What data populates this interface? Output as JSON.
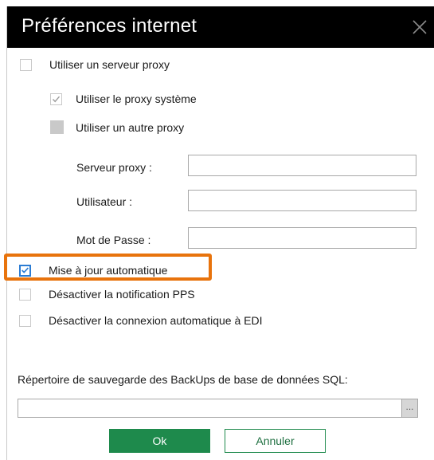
{
  "dialog": {
    "title": "Préférences internet",
    "close_icon": "close-icon"
  },
  "proxy": {
    "use_proxy_label": "Utiliser un serveur proxy",
    "use_proxy_checked": false,
    "system_proxy_label": "Utiliser le proxy système",
    "system_proxy_checked": true,
    "other_proxy_label": "Utiliser un autre proxy",
    "other_proxy_checked": false,
    "server_label": "Serveur proxy :",
    "server_value": "",
    "user_label": "Utilisateur :",
    "user_value": "",
    "password_label": "Mot de Passe :",
    "password_value": ""
  },
  "options": {
    "auto_update_label": "Mise à jour automatique",
    "auto_update_checked": true,
    "pps_label": "Désactiver la notification PPS",
    "pps_checked": false,
    "edi_label": "Désactiver la connexion automatique à EDI",
    "edi_checked": false
  },
  "backup": {
    "label": "Répertoire de sauvegarde des BackUps de base de données SQL:",
    "path_value": "",
    "browse_label": "..."
  },
  "buttons": {
    "ok_label": "Ok",
    "cancel_label": "Annuler"
  },
  "colors": {
    "titlebar": "#000000",
    "accent_green": "#1e8a4c",
    "highlight_orange": "#e8730c",
    "checkbox_blue": "#2b7cd3"
  }
}
